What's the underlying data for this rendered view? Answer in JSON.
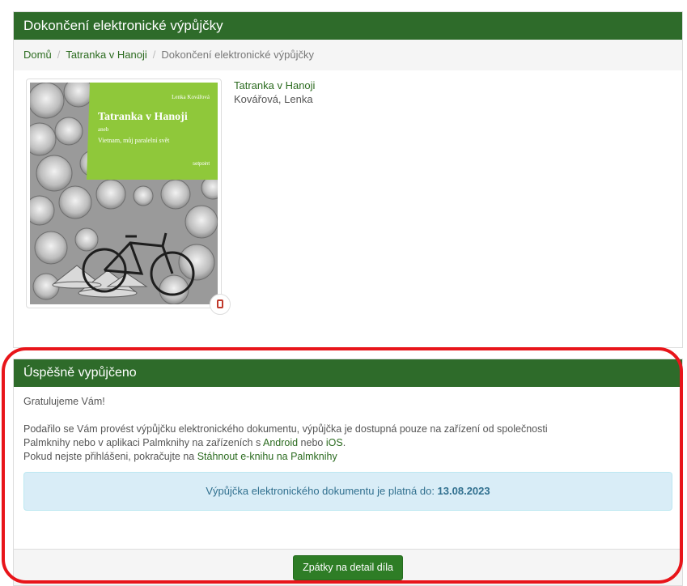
{
  "header": {
    "title": "Dokončení elektronické výpůjčky"
  },
  "breadcrumb": {
    "home": "Domů",
    "book": "Tatranka v Hanoji",
    "current": "Dokončení elektronické výpůjčky"
  },
  "book": {
    "title": "Tatranka v Hanoji",
    "author": "Kovářová, Lenka",
    "cover": {
      "author": "Lenka Kovářová",
      "title": "Tatranka v Hanoji",
      "aneb": "aneb",
      "subtitle": "Vietnam, můj paralelní svět",
      "publisher": "setpoint"
    },
    "badge_icon": "tablet-icon"
  },
  "result": {
    "title": "Úspěšně vypůjčeno",
    "greeting": "Gratulujeme Vám!",
    "text1": "Podařilo se Vám provést výpůjčku elektronického dokumentu, výpůjčka je dostupná pouze na zařízení od společnosti",
    "text2_a": "Palmknihy nebo v aplikaci Palmknihy na zařízeních s ",
    "text2_android": "Android",
    "text2_b": " nebo ",
    "text2_ios": "iOS",
    "text2_c": ".",
    "text3_a": "Pokud nejste přihlášeni, pokračujte na ",
    "text3_link": "Stáhnout e-knihu na Palmknihy",
    "alert_text": "Výpůjčka elektronického dokumentu je platná do: ",
    "alert_date": "13.08.2023",
    "back_button": "Zpátky na detail díla"
  },
  "colors": {
    "header_bg": "#2e6b2a",
    "link": "#2b6b1f",
    "alert_bg": "#d9edf7",
    "highlight": "#e8151a"
  }
}
